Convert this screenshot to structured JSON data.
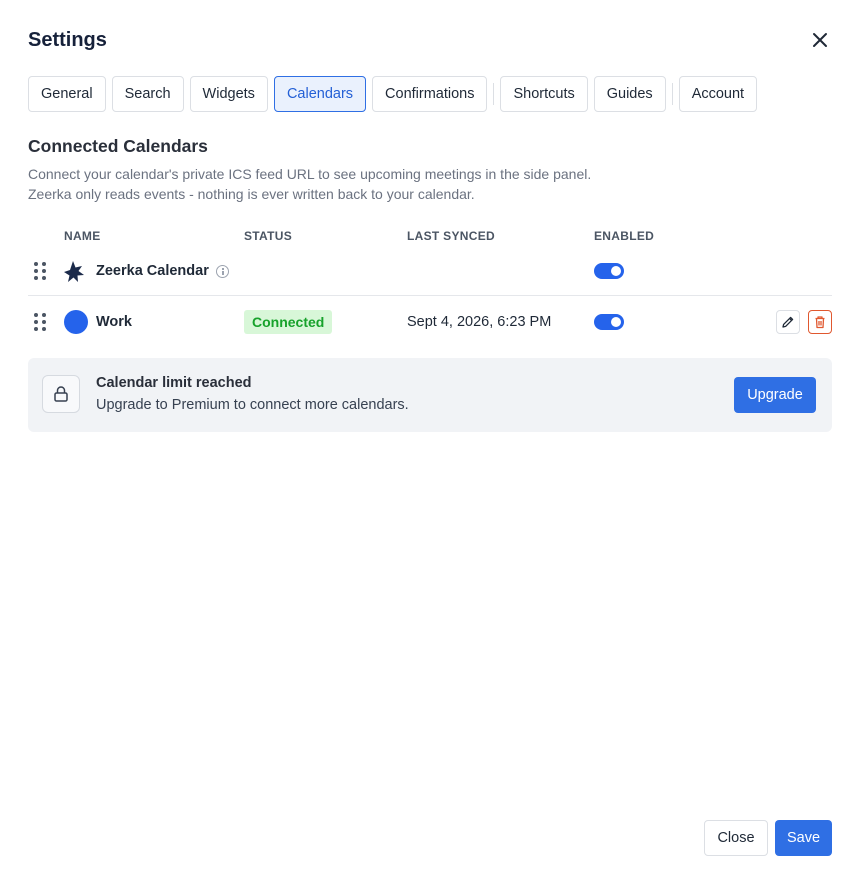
{
  "dialog": {
    "title": "Settings"
  },
  "tabs": [
    {
      "label": "General",
      "active": false
    },
    {
      "label": "Search",
      "active": false
    },
    {
      "label": "Widgets",
      "active": false
    },
    {
      "label": "Calendars",
      "active": true
    },
    {
      "label": "Confirmations",
      "active": false
    },
    {
      "label": "Shortcuts",
      "active": false
    },
    {
      "label": "Guides",
      "active": false
    },
    {
      "label": "Account",
      "active": false
    }
  ],
  "section": {
    "title": "Connected Calendars",
    "description_line1": "Connect your calendar's private ICS feed URL to see upcoming meetings in the side panel.",
    "description_line2": "Zeerka only reads events - nothing is ever written back to your calendar."
  },
  "table": {
    "columns": {
      "name": "NAME",
      "status": "STATUS",
      "last_synced": "LAST SYNCED",
      "enabled": "ENABLED"
    },
    "rows": [
      {
        "name": "Zeerka Calendar",
        "status": "",
        "last_synced": "",
        "enabled": true,
        "icon": "zeerka-logo-icon"
      },
      {
        "name": "Work",
        "status": "Connected",
        "last_synced": "Sept 4, 2026, 6:23 PM",
        "enabled": true,
        "icon": "calendar-color-dot",
        "color": "#2563eb"
      }
    ]
  },
  "limit": {
    "title": "Calendar limit reached",
    "text": "Upgrade to Premium to connect more calendars.",
    "button": "Upgrade"
  },
  "footer": {
    "close_label": "Close",
    "save_label": "Save"
  },
  "colors": {
    "accent": "#2f6fe4",
    "status_connected_bg": "#d8f7d8",
    "status_connected_text": "#17a22b",
    "danger": "#e0582f"
  }
}
